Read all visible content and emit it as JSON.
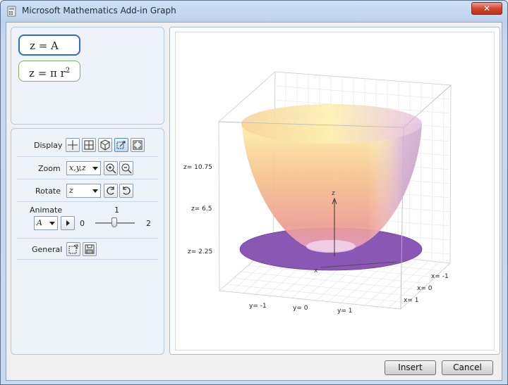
{
  "window": {
    "title": "Microsoft Mathematics Add-in Graph",
    "close_label": "✕"
  },
  "equations": [
    {
      "lhs": "z",
      "eq": "=",
      "rhs": "A"
    },
    {
      "lhs": "z",
      "eq": "=",
      "rhs": "π r",
      "exp": "2"
    }
  ],
  "controls": {
    "display_label": "Display",
    "zoom_label": "Zoom",
    "zoom_value": "x,y,z",
    "rotate_label": "Rotate",
    "rotate_value": "z",
    "animate_label": "Animate",
    "animate_var": "A",
    "slider_min": "0",
    "slider_value": "1",
    "slider_max": "2",
    "general_label": "General"
  },
  "graph": {
    "z_ticks": [
      "z= 10.75",
      "z= 6.5",
      "z= 2.25"
    ],
    "y_ticks": [
      "y= -1",
      "y= 0",
      "y= 1"
    ],
    "x_ticks": [
      "x= -1",
      "x= 0",
      "x= 1"
    ],
    "axis_z": "z",
    "axis_x": "x",
    "colors": {
      "surface_top": "#fdf0a8",
      "surface_bottom": "#ef9d8c",
      "disk": "#8b57b5"
    }
  },
  "buttons": {
    "insert": "Insert",
    "cancel": "Cancel"
  }
}
